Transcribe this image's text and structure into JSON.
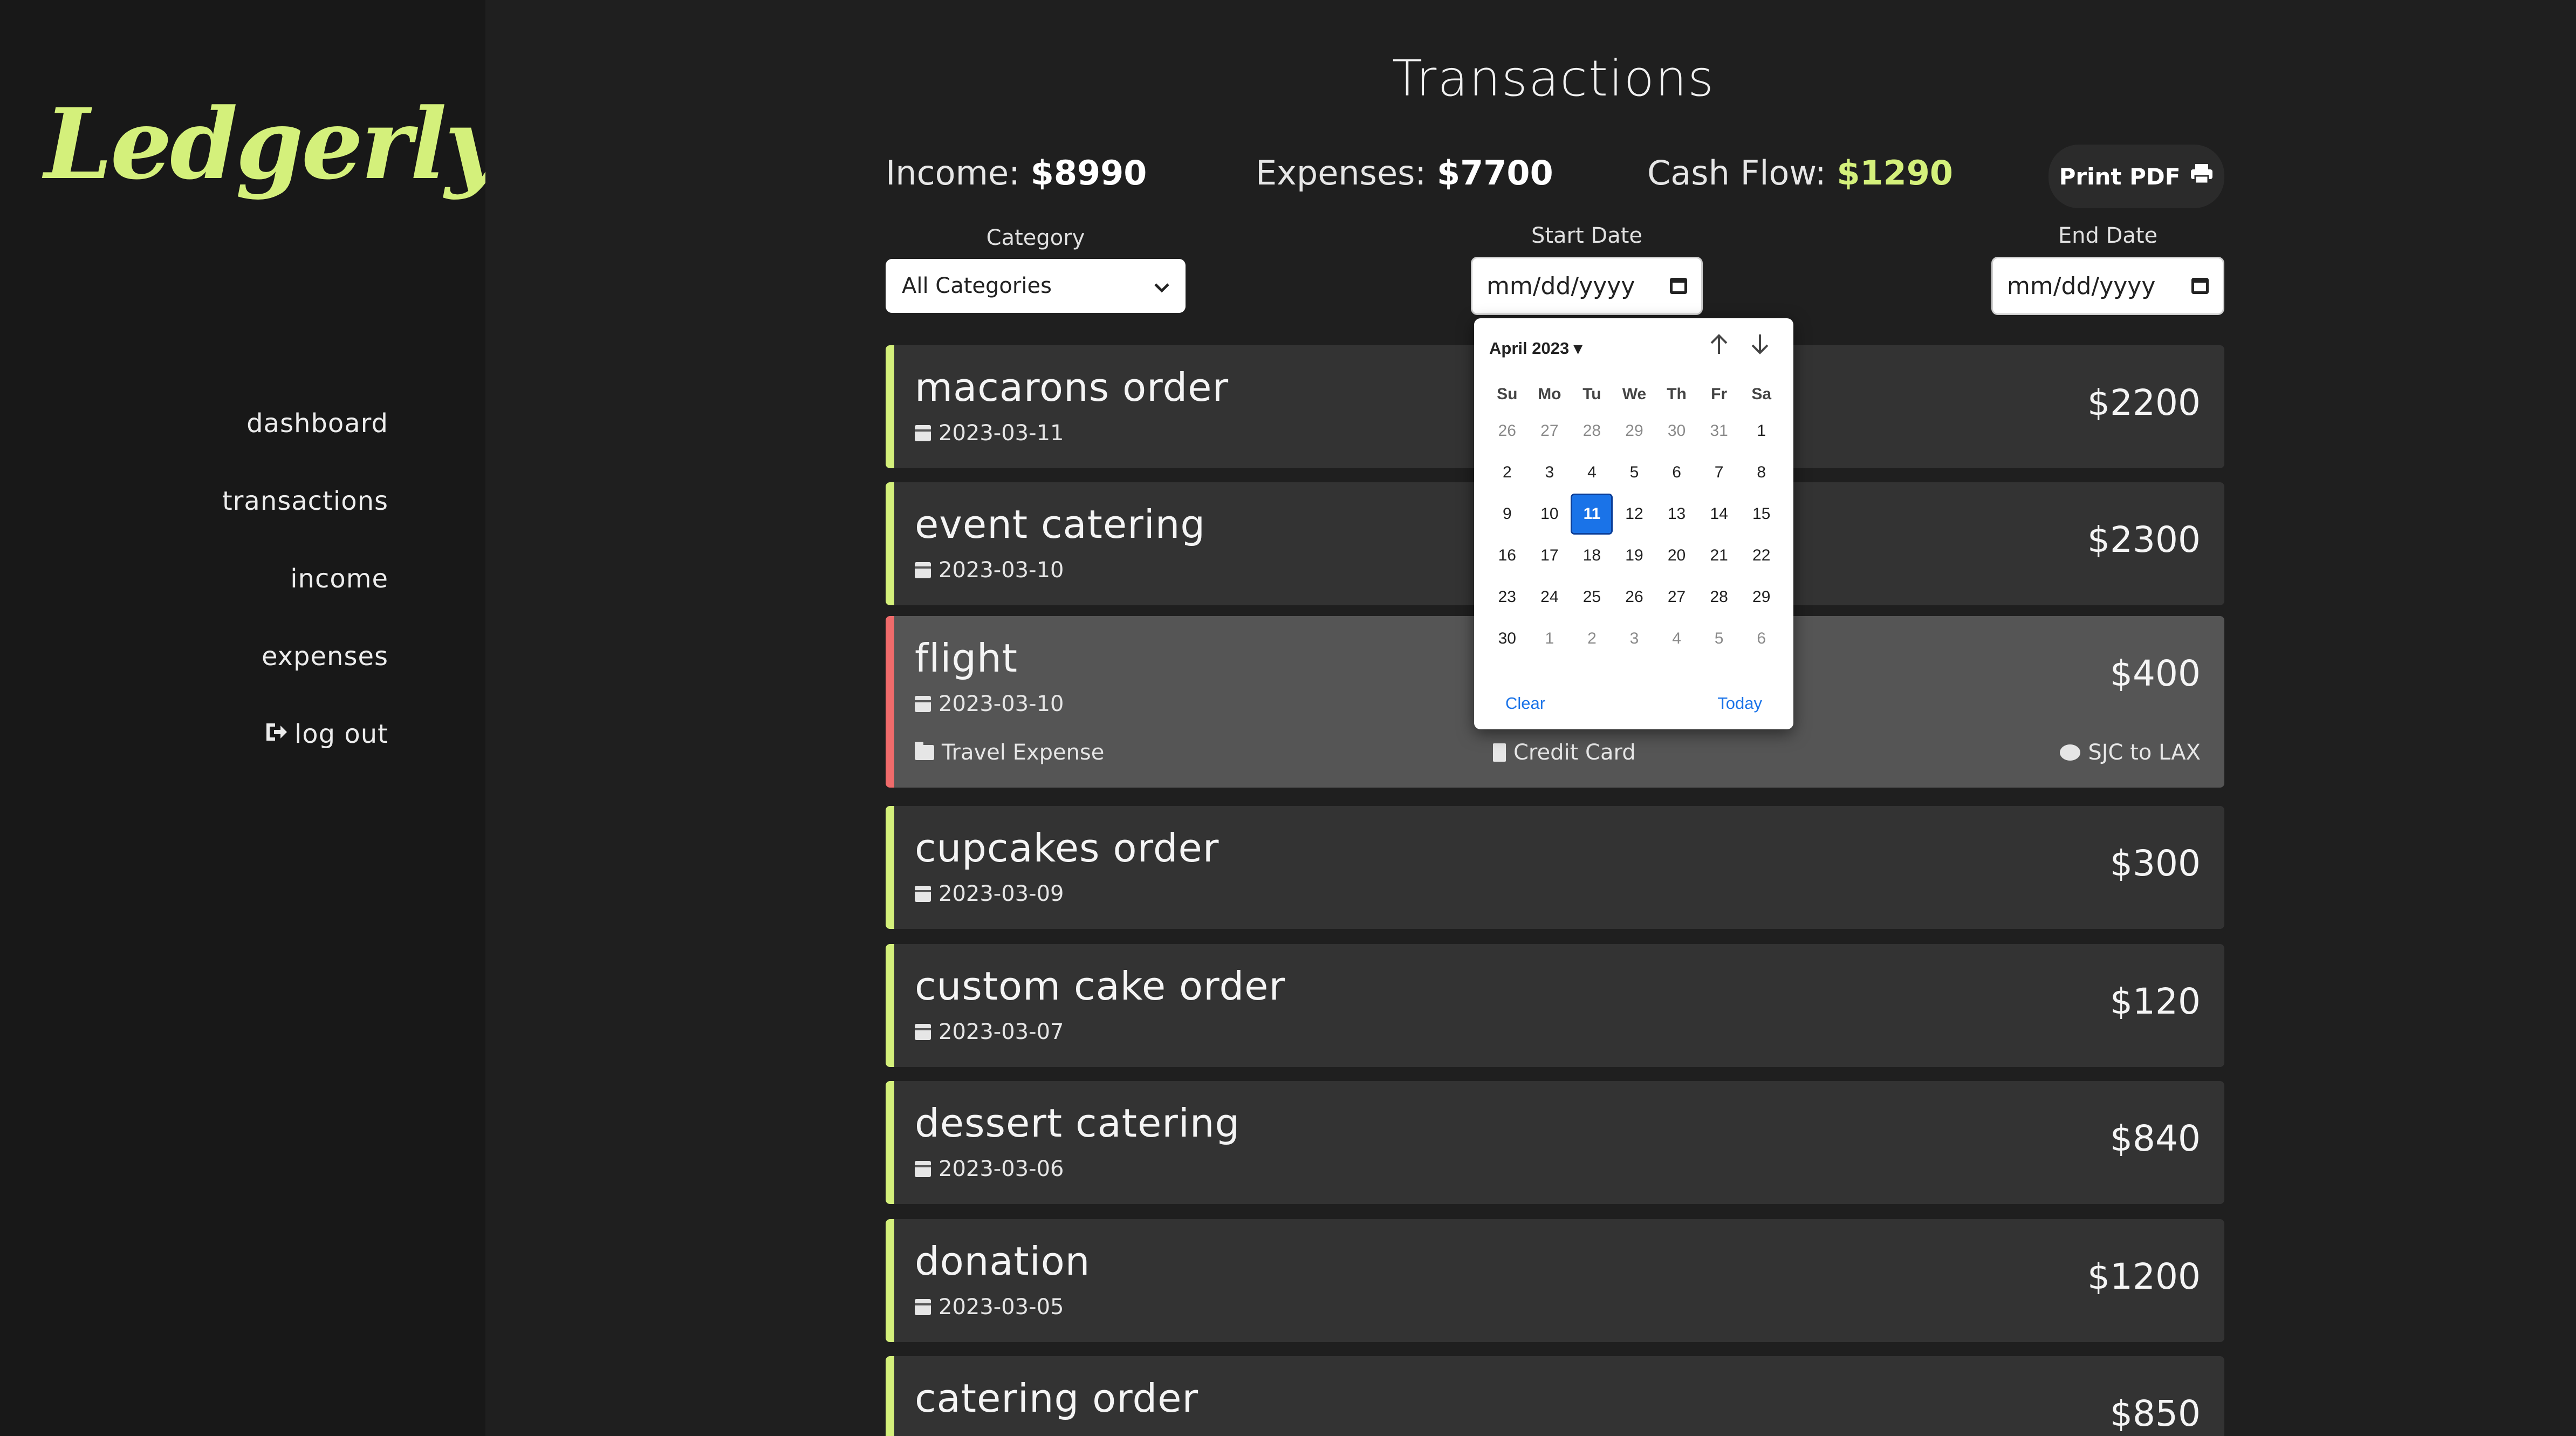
{
  "app": {
    "logo": "Ledgerly"
  },
  "sidebar": {
    "items": [
      {
        "label": "dashboard"
      },
      {
        "label": "transactions"
      },
      {
        "label": "income"
      },
      {
        "label": "expenses"
      },
      {
        "label": "log out",
        "icon": "sign-out-icon"
      }
    ]
  },
  "header": {
    "title": "Transactions",
    "income_label": "Income:",
    "income_value": "$8990",
    "expenses_label": "Expenses:",
    "expenses_value": "$7700",
    "cashflow_label": "Cash Flow:",
    "cashflow_value": "$1290",
    "print_label": "Print PDF",
    "print_icon": "printer-icon"
  },
  "filters": {
    "category_label": "Category",
    "category_value": "All Categories",
    "start_label": "Start Date",
    "start_placeholder": "mm/dd/yyyy",
    "end_label": "End Date",
    "end_placeholder": "mm/dd/yyyy"
  },
  "calendar": {
    "month": "April 2023",
    "dow": [
      "Su",
      "Mo",
      "Tu",
      "We",
      "Th",
      "Fr",
      "Sa"
    ],
    "days": [
      "26",
      "27",
      "28",
      "29",
      "30",
      "31",
      "1",
      "2",
      "3",
      "4",
      "5",
      "6",
      "7",
      "8",
      "9",
      "10",
      "11",
      "12",
      "13",
      "14",
      "15",
      "16",
      "17",
      "18",
      "19",
      "20",
      "21",
      "22",
      "23",
      "24",
      "25",
      "26",
      "27",
      "28",
      "29",
      "30",
      "1",
      "2",
      "3",
      "4",
      "5",
      "6"
    ],
    "selected": "11",
    "clear": "Clear",
    "today": "Today"
  },
  "transactions": [
    {
      "title": "macarons order",
      "date": "2023-03-11",
      "amount": "$2200"
    },
    {
      "title": "event catering",
      "date": "2023-03-10",
      "amount": "$2300"
    },
    {
      "title": "flight",
      "date": "2023-03-10",
      "amount": "$400",
      "category": "Travel Expense",
      "payment": "Credit Card",
      "note": "SJC to LAX"
    },
    {
      "title": "cupcakes order",
      "date": "2023-03-09",
      "amount": "$300"
    },
    {
      "title": "custom cake order",
      "date": "2023-03-07",
      "amount": "$120"
    },
    {
      "title": "dessert catering",
      "date": "2023-03-06",
      "amount": "$840"
    },
    {
      "title": "donation",
      "date": "2023-03-05",
      "amount": "$1200"
    },
    {
      "title": "catering order",
      "date": "",
      "amount": "$850"
    }
  ],
  "colors": {
    "accent": "#d4f07b",
    "expense": "#f06b6b",
    "calendar_selected": "#1a73e8"
  }
}
